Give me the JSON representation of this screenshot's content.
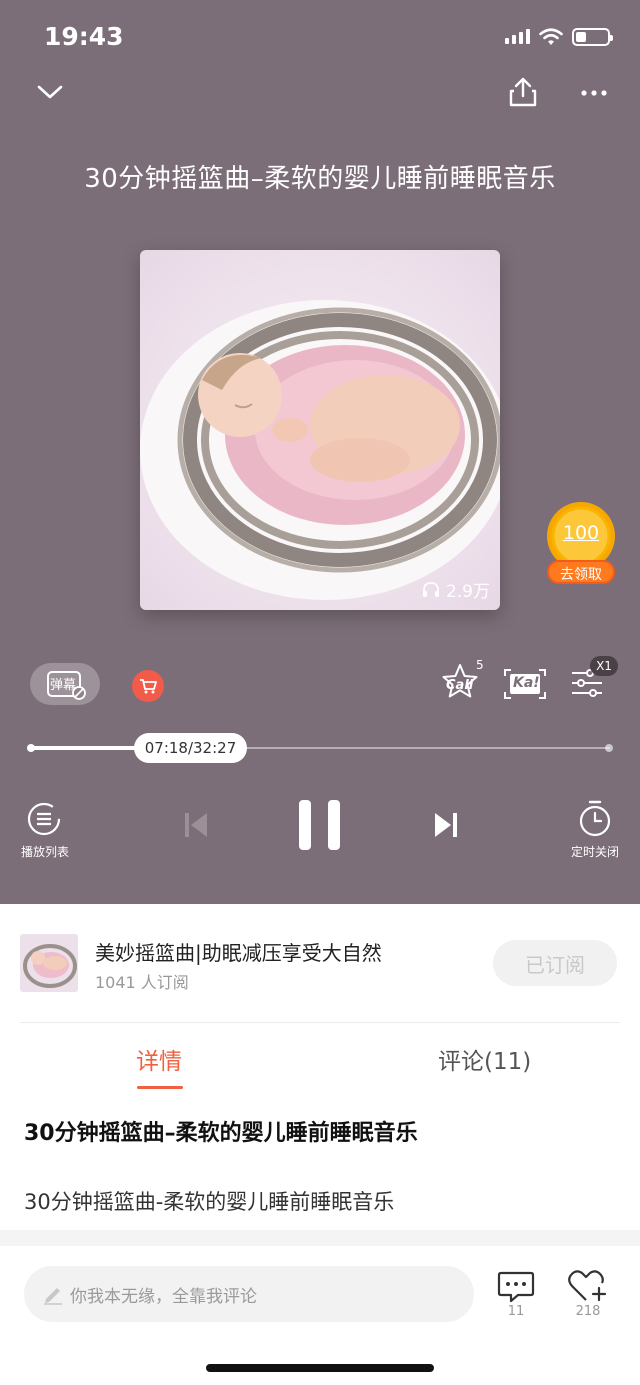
{
  "status_bar": {
    "time": "19:43"
  },
  "header": {
    "title": "30分钟摇篮曲–柔软的婴儿睡前睡眠音乐"
  },
  "cover": {
    "play_count": "2.9万"
  },
  "reward": {
    "amount": "100",
    "label": "去领取"
  },
  "tools": {
    "danmaku_label": "弹幕",
    "call_label": "Call",
    "call_count": "5",
    "ka_label": "Ka!",
    "speed_badge": "X1"
  },
  "progress": {
    "time": "07:18/32:27",
    "fraction": 0.225
  },
  "controls": {
    "playlist_label": "播放列表",
    "timer_label": "定时关闭"
  },
  "album": {
    "name": "美妙摇篮曲|助眠减压享受大自然",
    "subscribers": "1041 人订阅",
    "subscribe_button": "已订阅"
  },
  "tabs": {
    "detail": "详情",
    "comments": "评论(11)"
  },
  "detail": {
    "title": "30分钟摇篮曲–柔软的婴儿睡前睡眠音乐",
    "body": "30分钟摇篮曲-柔软的婴儿睡前睡眠音乐"
  },
  "bottom": {
    "comment_placeholder": "你我本无缘，全靠我评论",
    "comment_count": "11",
    "like_count": "218"
  },
  "colors": {
    "player_bg": "#7c6e78",
    "accent": "#f0623e",
    "reward_gold": "#f7b500"
  }
}
